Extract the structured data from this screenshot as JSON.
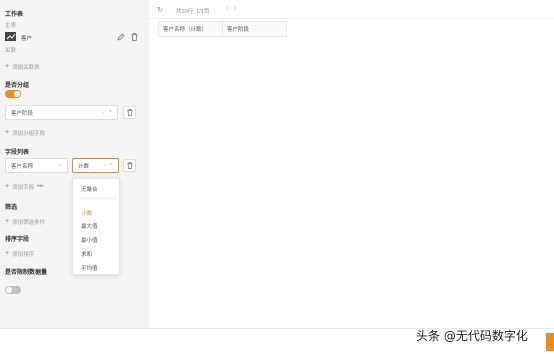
{
  "sidebar": {
    "workspace_title": "工作表",
    "primary_label": "主表",
    "primary_table": "客户",
    "related_label": "关联",
    "add_related": "添加关联表",
    "group_title": "是否分组",
    "group_enabled": true,
    "group_field": "客户阶段",
    "add_group_field": "添加分组字段",
    "fields_title": "字段列表",
    "field_name": "客户名称",
    "field_agg": "计数",
    "add_field": "添加字段",
    "filter_title": "筛选",
    "add_filter": "添加筛选条件",
    "sort_title": "排序字段",
    "add_sort": "添加排序",
    "limit_title": "是否限制数据量",
    "limit_enabled": false
  },
  "aggregate_dropdown": {
    "options": [
      "无聚合",
      "计数",
      "最大值",
      "最小值",
      "求和",
      "平均值"
    ],
    "selected": "计数"
  },
  "toolbar": {
    "pagination": "共10行, 1/1页"
  },
  "table": {
    "headers": [
      "客户名称（计数）",
      "客户阶段"
    ]
  },
  "watermark": "头条 @无代码数字化",
  "colors": {
    "accent": "#f08a24",
    "sidebar_bg": "#f4f4f5"
  }
}
